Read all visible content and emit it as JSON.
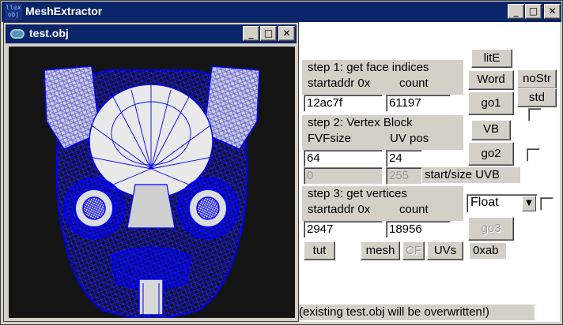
{
  "window": {
    "title": "MeshExtractor",
    "icon_text": "ll◎x obj",
    "icon": "obj-app-icon",
    "controls": {
      "minimize": "_",
      "maximize": "□",
      "close": "✕"
    }
  },
  "child_window": {
    "title": "test.obj",
    "icon": "document-icon",
    "controls": {
      "minimize": "_",
      "maximize": "□",
      "close": "✕"
    },
    "viewport": "wireframe-head-model"
  },
  "step1": {
    "heading": "step 1: get face indices",
    "startaddr_label": "startaddr 0x",
    "count_label": "count",
    "startaddr_value": "12ac7f",
    "count_value": "61197",
    "go_button": "go1"
  },
  "side_buttons": {
    "litE": "litE",
    "word": "Word",
    "noStr": "noStr",
    "std": "std",
    "vb": "VB"
  },
  "step2": {
    "heading": "step 2: Vertex Block",
    "fvf_label": "FVFsize",
    "uvpos_label": "UV pos",
    "fvf_value": "64",
    "uvpos_value": "24",
    "uvb_start_value": "0",
    "uvb_size_value": "255",
    "uvb_label": "start/size UVB",
    "go_button": "go2"
  },
  "step3": {
    "heading": "step 3: get vertices",
    "startaddr_label": "startaddr 0x",
    "count_label": "count",
    "startaddr_value": "2947",
    "count_value": "18956",
    "type_select": "Float",
    "go_button": "go3"
  },
  "bottom_buttons": {
    "tut": "tut",
    "mesh": "mesh",
    "cf": "CF",
    "uvs": "UVs",
    "hex": "0xab"
  },
  "status": "(existing test.obj will be overwritten!)",
  "colors": {
    "titlebar": "#0a246a",
    "face": "#d4d0c8",
    "wire": "#0000ff",
    "viewport_bg": "#141414"
  }
}
